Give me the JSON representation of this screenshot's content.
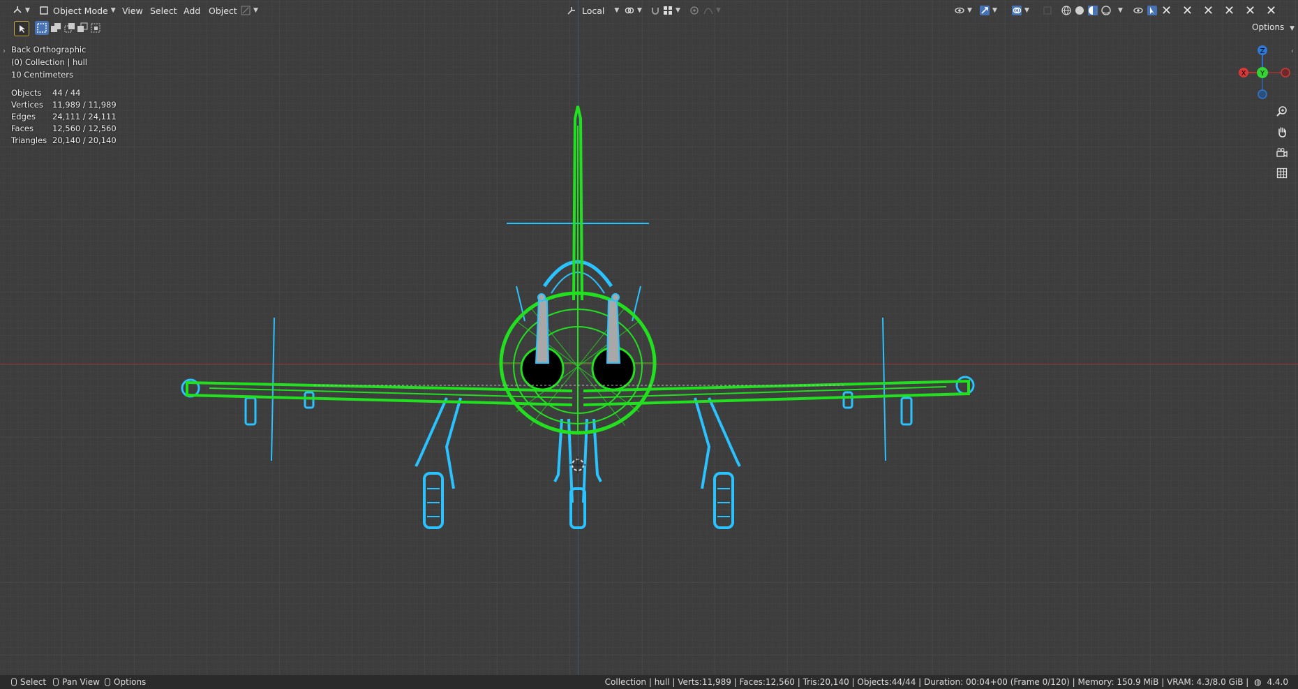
{
  "header": {
    "mode_label": "Object Mode",
    "menus": [
      "View",
      "Select",
      "Add",
      "Object"
    ],
    "transform_orientation": "Local"
  },
  "overlay": {
    "view_name": "Back Orthographic",
    "collection": "(0) Collection | hull",
    "scale": "10 Centimeters",
    "stats": [
      {
        "label": "Objects",
        "value": "44 / 44"
      },
      {
        "label": "Vertices",
        "value": "11,989 / 11,989"
      },
      {
        "label": "Edges",
        "value": "24,111 / 24,111"
      },
      {
        "label": "Faces",
        "value": "12,560 / 12,560"
      },
      {
        "label": "Triangles",
        "value": "20,140 / 20,140"
      }
    ]
  },
  "right": {
    "options_label": "Options",
    "gizmo": {
      "x": "X",
      "y": "Y",
      "z": "Z"
    }
  },
  "statusbar": {
    "select": "Select",
    "pan_view": "Pan View",
    "options": "Options",
    "info": "Collection | hull | Verts:11,989 | Faces:12,560 | Tris:20,140 | Objects:44/44 | Duration: 00:04+00 (Frame 0/120) | Memory: 150.9 MiB | VRAM: 4.3/8.0 GiB |",
    "version": "4.4.0"
  },
  "colors": {
    "wire_active": "#22e01f",
    "wire_selected": "#2bc3ff",
    "background": "#3d3d3d"
  }
}
